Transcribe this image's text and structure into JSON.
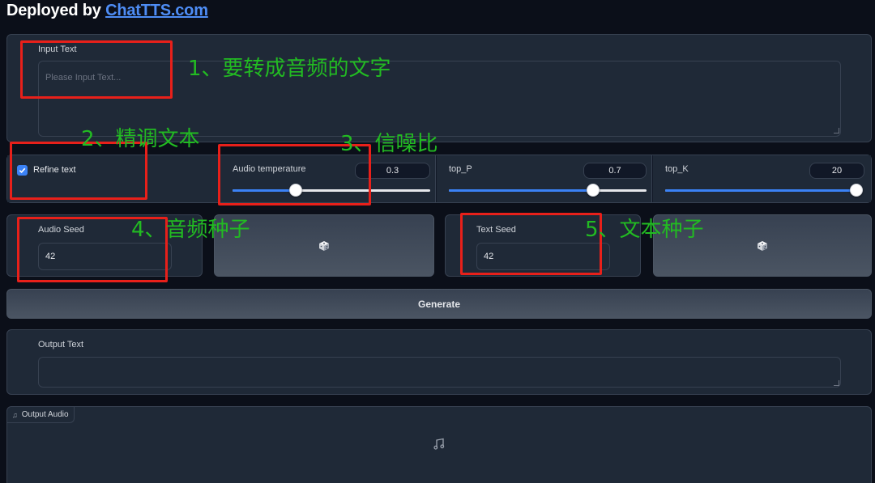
{
  "header": {
    "prefix": "Deployed by ",
    "link_text": "ChatTTS.com"
  },
  "input_text": {
    "label": "Input Text",
    "placeholder": "Please Input Text..."
  },
  "refine": {
    "label": "Refine text",
    "checked": true
  },
  "sliders": [
    {
      "label": "Audio temperature",
      "value": "0.3",
      "fraction": 0.32
    },
    {
      "label": "top_P",
      "value": "0.7",
      "fraction": 0.73
    },
    {
      "label": "top_K",
      "value": "20",
      "fraction": 1.0
    }
  ],
  "audio_seed": {
    "label": "Audio Seed",
    "value": "42",
    "dice_icon": "dice-icon"
  },
  "text_seed": {
    "label": "Text Seed",
    "value": "42",
    "dice_icon": "dice-icon"
  },
  "generate": {
    "label": "Generate"
  },
  "output_text": {
    "label": "Output Text",
    "value": ""
  },
  "output_audio": {
    "label": "Output Audio",
    "icon": "music-note-icon"
  },
  "annotations": {
    "a1": "1、要转成音频的文字",
    "a2": "2、精调文本",
    "a3": "3、信噪比",
    "a4": "4、音频种子",
    "a5": "5、文本种子"
  },
  "colors": {
    "accent": "#3b82f6",
    "annotation_box": "#e8201a",
    "annotation_text": "#22bb22",
    "background": "#0b0f19",
    "link": "#4e8df5"
  }
}
